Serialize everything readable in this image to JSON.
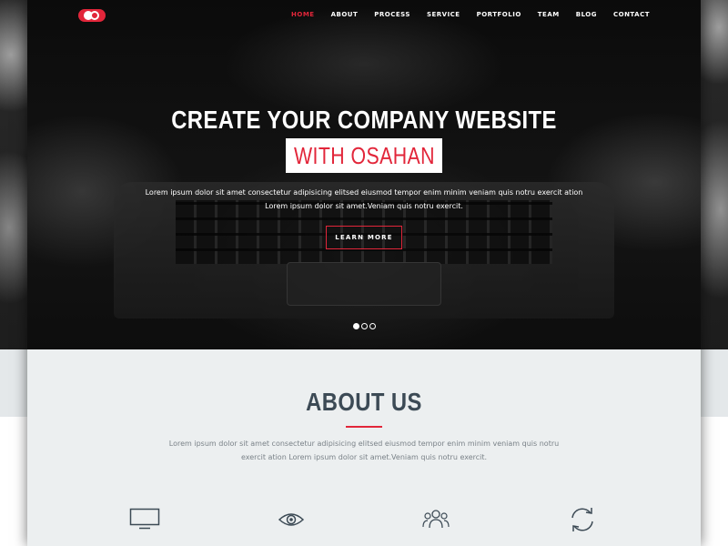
{
  "nav": {
    "items": [
      {
        "label": "HOME",
        "active": true
      },
      {
        "label": "ABOUT",
        "active": false
      },
      {
        "label": "PROCESS",
        "active": false
      },
      {
        "label": "SERVICE",
        "active": false
      },
      {
        "label": "PORTFOLIO",
        "active": false
      },
      {
        "label": "TEAM",
        "active": false
      },
      {
        "label": "BLOG",
        "active": false
      },
      {
        "label": "CONTACT",
        "active": false
      }
    ]
  },
  "hero": {
    "title": "CREATE YOUR COMPANY WEBSITE",
    "highlight": "WITH OSAHAN",
    "text_line1": "Lorem ipsum dolor sit amet consectetur adipisicing elitsed eiusmod tempor enim minim veniam quis notru exercit ation",
    "text_line2": "Lorem ipsum dolor sit amet.Veniam quis notru exercit.",
    "button": "LEARN MORE",
    "slides": 3,
    "active_slide": 1
  },
  "about": {
    "title": "ABOUT US",
    "text": "Lorem ipsum dolor sit amet consectetur adipisicing elitsed eiusmod tempor enim minim veniam quis notru exercit ation Lorem ipsum dolor sit amet.Veniam quis notru exercit.",
    "icons": [
      "monitor-icon",
      "eye-icon",
      "team-icon",
      "refresh-icon"
    ]
  },
  "colors": {
    "accent": "#e2263a",
    "about_bg": "#eceff0",
    "heading": "#3c4a55"
  }
}
